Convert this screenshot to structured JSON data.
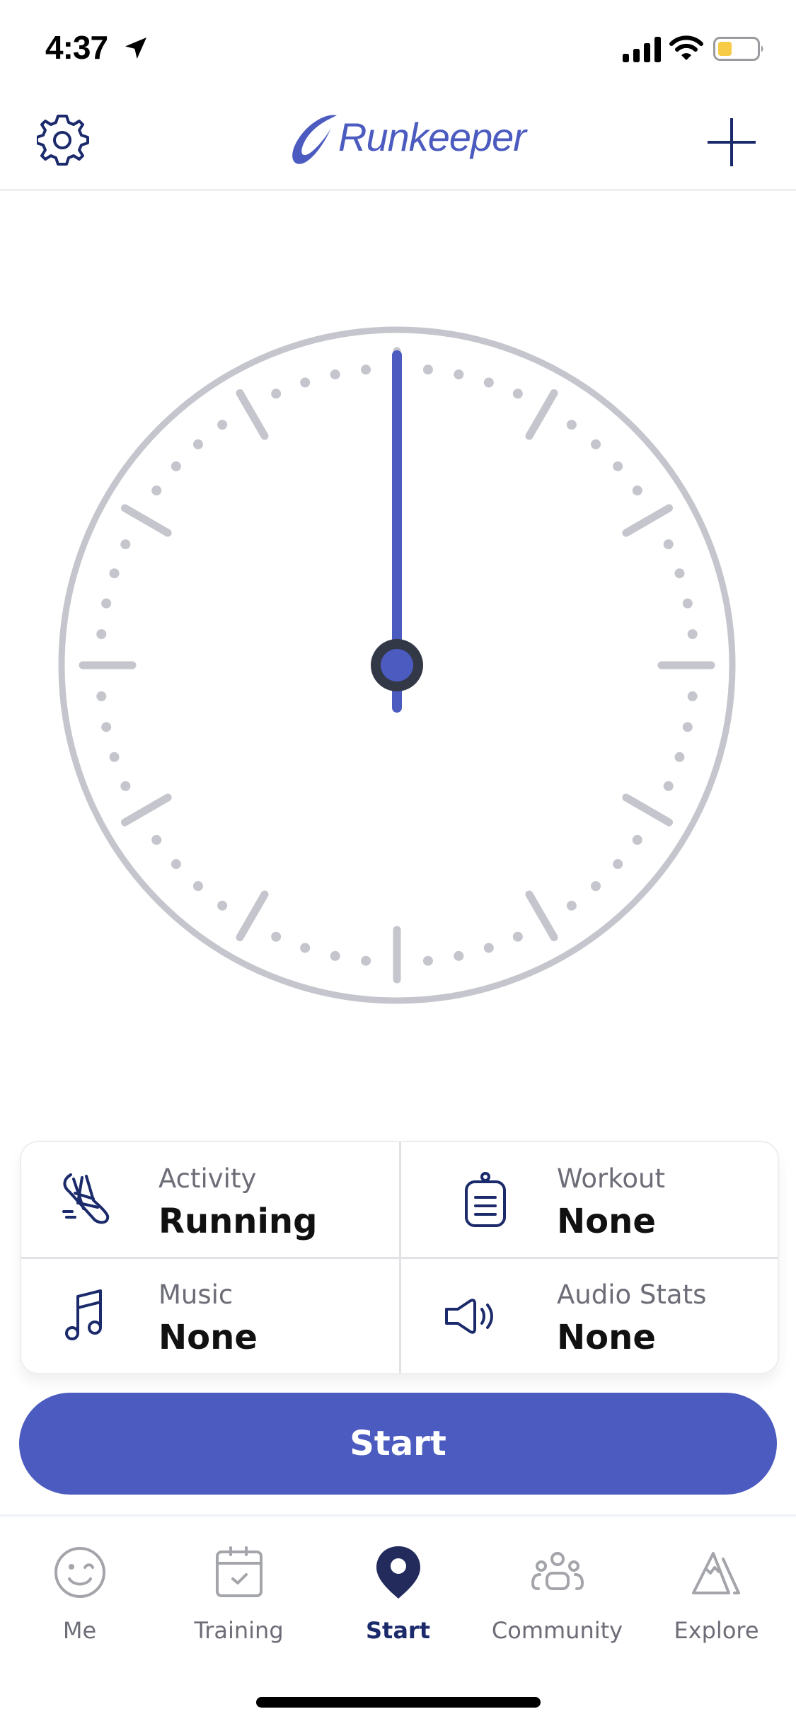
{
  "status_bar": {
    "time": "4:37",
    "icons": [
      "location-arrow-icon",
      "cellular-signal-icon",
      "wifi-icon",
      "battery-icon"
    ],
    "battery_color": "#f7cb45"
  },
  "nav": {
    "brand": "Runkeeper",
    "left_icon": "gear-icon",
    "right_icon": "plus-icon",
    "brand_color": "#4b5bbf"
  },
  "stopwatch": {
    "hand_position_seconds": 0,
    "hand_color": "#4b5bbf",
    "face_color": "#c5c6cd"
  },
  "settings": [
    {
      "label": "Activity",
      "value": "Running",
      "icon": "running-shoe-icon"
    },
    {
      "label": "Workout",
      "value": "None",
      "icon": "clipboard-icon"
    },
    {
      "label": "Music",
      "value": "None",
      "icon": "music-note-icon"
    },
    {
      "label": "Audio Stats",
      "value": "None",
      "icon": "speaker-icon"
    }
  ],
  "start_button": {
    "label": "Start",
    "color": "#4b5bbf"
  },
  "tabs": [
    {
      "label": "Me",
      "icon": "smiley-icon",
      "active": false
    },
    {
      "label": "Training",
      "icon": "calendar-check-icon",
      "active": false
    },
    {
      "label": "Start",
      "icon": "map-pin-icon",
      "active": true
    },
    {
      "label": "Community",
      "icon": "group-icon",
      "active": false
    },
    {
      "label": "Explore",
      "icon": "mountain-icon",
      "active": false
    }
  ]
}
